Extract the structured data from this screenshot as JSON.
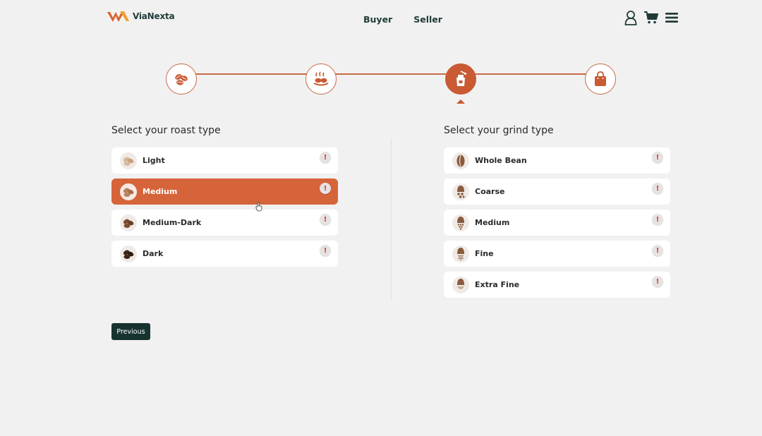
{
  "header": {
    "brand": "ViaNexta",
    "nav": [
      "Buyer",
      "Seller"
    ],
    "icons": [
      "user-icon",
      "cart-icon",
      "menu-icon"
    ]
  },
  "stepper": {
    "steps": [
      "coffee-beans-icon",
      "roasting-icon",
      "grinder-icon",
      "shopping-bag-icon"
    ],
    "active_index": 2
  },
  "roast": {
    "title": "Select your roast type",
    "options": [
      "Light",
      "Medium",
      "Medium-Dark",
      "Dark"
    ],
    "selected": "Medium"
  },
  "grind": {
    "title": "Select your grind type",
    "options": [
      "Whole Bean",
      "Coarse",
      "Medium",
      "Fine",
      "Extra Fine"
    ]
  },
  "info_glyph": "!",
  "previous_label": "Previous",
  "colors": {
    "accent": "#d6643a",
    "dark": "#173330",
    "background": "#f1f1f1"
  }
}
